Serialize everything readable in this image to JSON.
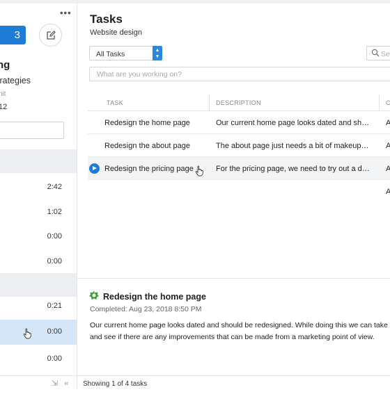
{
  "sidebar": {
    "more_label": "•••",
    "start_button_label": "3",
    "project_name": "ng",
    "project_sub": "trategies",
    "meta_line1": "nit",
    "meta_line2": "12",
    "times": [
      "2:42",
      "1:02",
      "0:00",
      "0:00",
      "0:21",
      "0:00",
      "0:00"
    ],
    "footer_icons": "⇲ «"
  },
  "main": {
    "title": "Tasks",
    "subtitle": "Website design",
    "filter_label": "All Tasks",
    "search_placeholder": "Se",
    "input_placeholder": "What are you working on?",
    "columns": [
      "TASK",
      "DESCRIPTION",
      "C"
    ],
    "rows": [
      {
        "task": "Redesign the home page",
        "description": "Our current home page looks dated and should…",
        "extra": "A"
      },
      {
        "task": "Redesign the about page",
        "description": "The about page just needs a bit of makeup, bec…",
        "extra": "A"
      },
      {
        "task": "Redesign the pricing page",
        "description": "For the pricing page, we need to try out a differe…",
        "extra": "A"
      },
      {
        "task": "",
        "description": "",
        "extra": "A"
      }
    ],
    "detail": {
      "title": "Redesign the home page",
      "completed": "Completed: Aug 23, 2018 8:50 PM",
      "line1": "Our current home page looks dated and should be redesigned. While doing this we can take a loo",
      "line2": "and see if there are any improvements that can be made from a marketing point of view."
    },
    "footer": "Showing 1 of 4 tasks"
  },
  "colors": {
    "accent": "#1f7bd8",
    "selected_row": "#d5e6f8",
    "group_header": "#eceef1"
  }
}
